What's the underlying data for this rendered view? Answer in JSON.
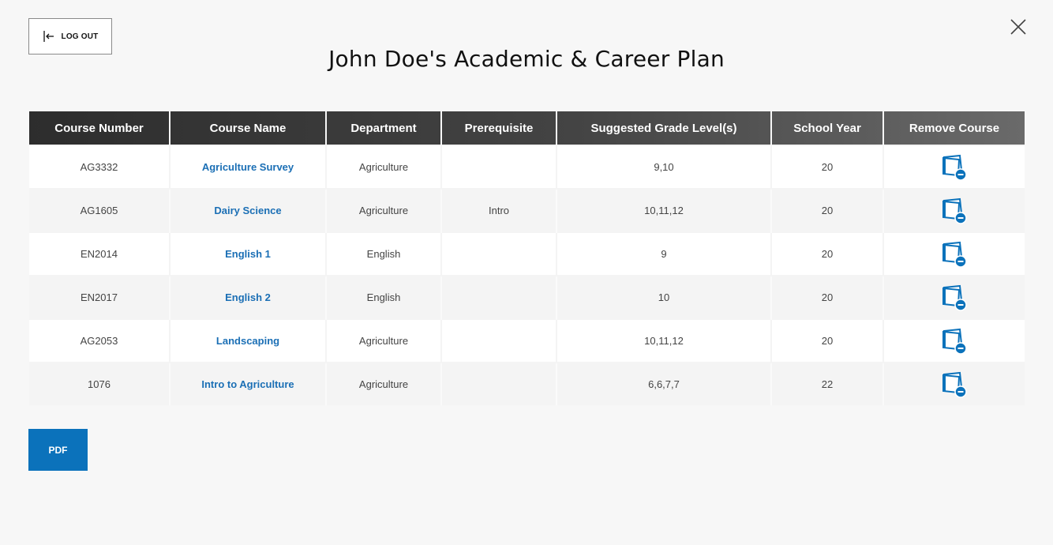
{
  "header": {
    "logout_label": "LOG OUT",
    "title": "John Doe's Academic & Career Plan"
  },
  "table": {
    "columns": [
      "Course Number",
      "Course Name",
      "Department",
      "Prerequisite",
      "Suggested Grade Level(s)",
      "School Year",
      "Remove Course"
    ],
    "rows": [
      {
        "number": "AG3332",
        "name": "Agriculture Survey",
        "department": "Agriculture",
        "prerequisite": "",
        "grades": "9,10",
        "year": "20"
      },
      {
        "number": "AG1605",
        "name": "Dairy Science",
        "department": "Agriculture",
        "prerequisite": "Intro",
        "grades": "10,11,12",
        "year": "20"
      },
      {
        "number": "EN2014",
        "name": "English 1",
        "department": "English",
        "prerequisite": "",
        "grades": "9",
        "year": "20"
      },
      {
        "number": "EN2017",
        "name": "English 2",
        "department": "English",
        "prerequisite": "",
        "grades": "10",
        "year": "20"
      },
      {
        "number": "AG2053",
        "name": "Landscaping",
        "department": "Agriculture",
        "prerequisite": "",
        "grades": "10,11,12",
        "year": "20"
      },
      {
        "number": "1076",
        "name": "Intro to Agriculture",
        "department": "Agriculture",
        "prerequisite": "",
        "grades": "6,6,7,7",
        "year": "22"
      }
    ]
  },
  "actions": {
    "pdf_label": "PDF"
  },
  "icons": {
    "logout": "logout-icon",
    "close": "close-icon",
    "remove": "remove-course-icon"
  },
  "colors": {
    "accent": "#0b72bb",
    "link": "#1b6fb5",
    "header_dark": "#2d2d2d",
    "header_light": "#6a6a6a",
    "background": "#f7f7f7"
  }
}
